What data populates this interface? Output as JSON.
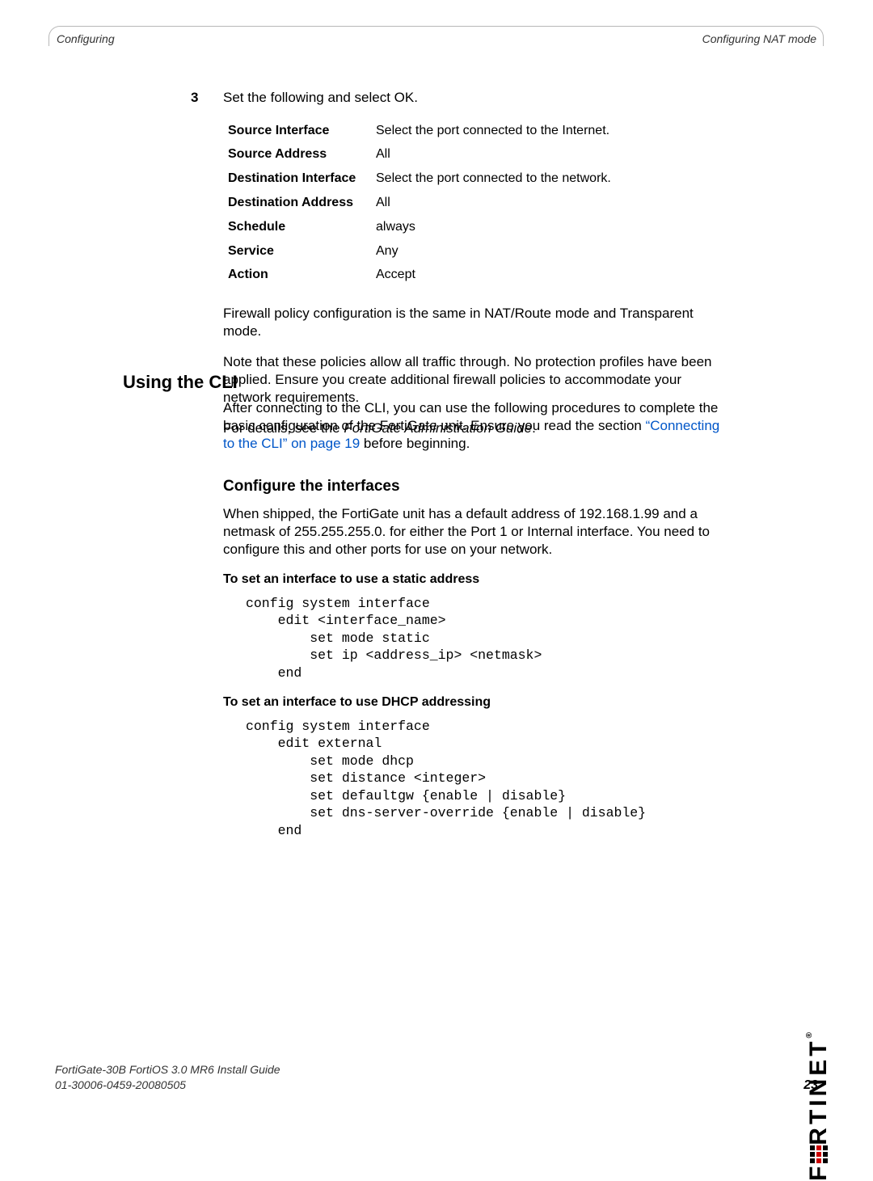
{
  "header": {
    "left": "Configuring",
    "right": "Configuring NAT mode"
  },
  "step": {
    "num": "3",
    "text": "Set the following and select OK."
  },
  "settings": [
    {
      "key": "Source Interface",
      "val": "Select the port connected to the Internet."
    },
    {
      "key": "Source Address",
      "val": "All"
    },
    {
      "key": "Destination Interface",
      "val": "Select the port connected to the network."
    },
    {
      "key": "Destination Address",
      "val": "All"
    },
    {
      "key": "Schedule",
      "val": "always"
    },
    {
      "key": "Service",
      "val": "Any"
    },
    {
      "key": "Action",
      "val": "Accept"
    }
  ],
  "paras": {
    "p1": "Firewall policy configuration is the same in NAT/Route mode and Transparent mode.",
    "p2": "Note that these policies allow all traffic through. No protection profiles have been applied. Ensure you create additional firewall policies to accommodate your network requirements.",
    "p3_pre": "For details, see the ",
    "p3_em": "FortiGate Administration Guide",
    "p3_post": "."
  },
  "h2_cli": "Using the CLI",
  "cli_para_pre": "After connecting to the CLI, you can use the following procedures to complete the basic configuration of the FortiGate unit. Ensure you read the section ",
  "cli_link": "“Connecting to the CLI” on page 19",
  "cli_para_post": " before beginning.",
  "h3_conf": "Configure the interfaces",
  "conf_para": "When shipped, the FortiGate unit has a default address of 192.168.1.99 and a netmask of 255.255.255.0. for either the Port 1 or Internal interface. You need to configure this and other ports for use on your network.",
  "h4_static": "To set an interface to use a static address",
  "code_static": "config system interface\n    edit <interface_name>\n        set mode static\n        set ip <address_ip> <netmask>\n    end",
  "h4_dhcp": "To set an interface to use DHCP addressing",
  "code_dhcp": "config system interface\n    edit external\n        set mode dhcp\n        set distance <integer>\n        set defaultgw {enable | disable}\n        set dns-server-override {enable | disable}\n    end",
  "footer": {
    "line1": "FortiGate-30B FortiOS 3.0 MR6 Install Guide",
    "line2": "01-30006-0459-20080505",
    "page": "23"
  },
  "brand_pre": "F",
  "brand_post": "RTINET"
}
